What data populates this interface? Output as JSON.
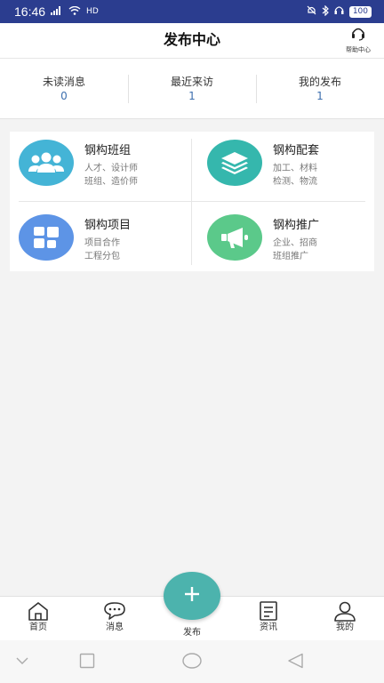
{
  "status_bar": {
    "time": "16:46",
    "signal": "⁴ᴳ",
    "hd": "HD",
    "battery": "100"
  },
  "header": {
    "title": "发布中心",
    "help_label": "帮助中心"
  },
  "stats": [
    {
      "label": "未读消息",
      "value": "0"
    },
    {
      "label": "最近来访",
      "value": "1"
    },
    {
      "label": "我的发布",
      "value": "1"
    }
  ],
  "categories": [
    {
      "title": "钢构班组",
      "line1": "人才、设计师",
      "line2": "班组、造价师",
      "color": "#44b4d6",
      "icon": "group-icon"
    },
    {
      "title": "钢构配套",
      "line1": "加工、材料",
      "line2": "检测、物流",
      "color": "#35b7ad",
      "icon": "layers-icon"
    },
    {
      "title": "钢构项目",
      "line1": "项目合作",
      "line2": "工程分包",
      "color": "#5d94e6",
      "icon": "blocks-icon"
    },
    {
      "title": "钢构推广",
      "line1": "企业、招商",
      "line2": "班组推广",
      "color": "#5bc98a",
      "icon": "megaphone-icon"
    }
  ],
  "tabbar": {
    "home": "首页",
    "messages": "消息",
    "publish": "发布",
    "news": "资讯",
    "mine": "我的"
  }
}
